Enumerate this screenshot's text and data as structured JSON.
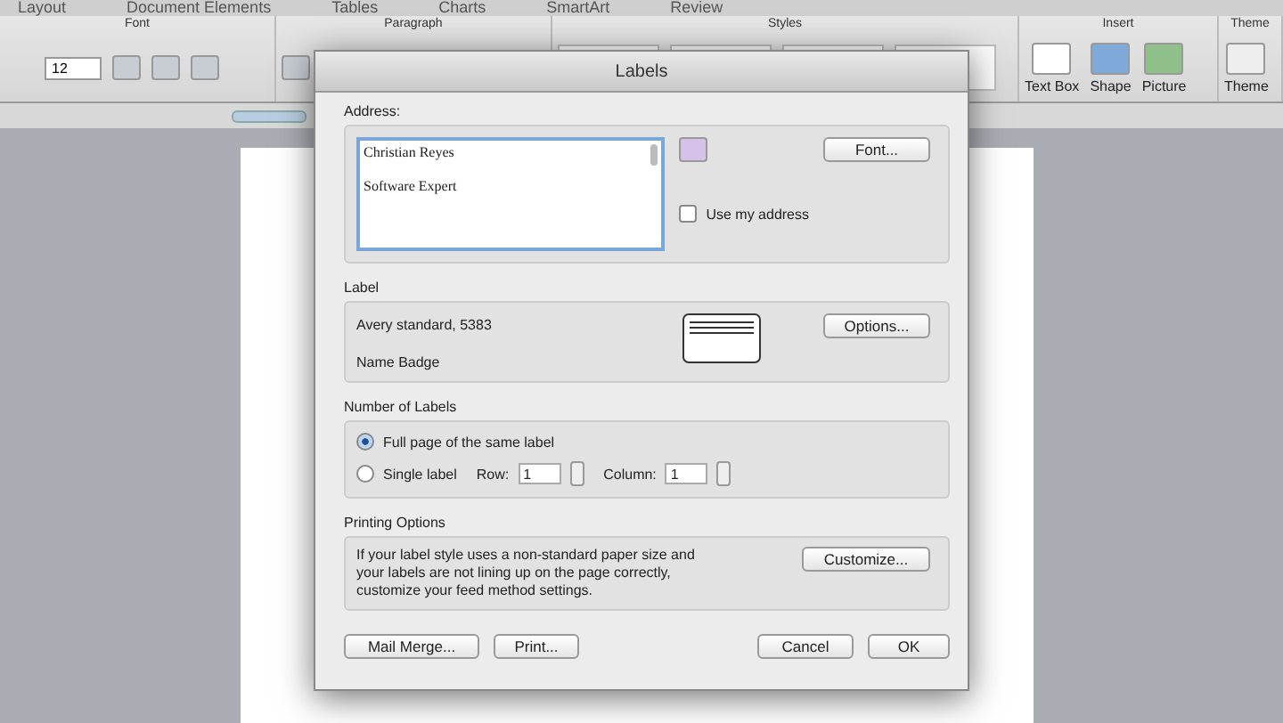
{
  "ribbon": {
    "tabs": [
      "Layout",
      "Document Elements",
      "Tables",
      "Charts",
      "SmartArt",
      "Review"
    ],
    "groups": [
      "Font",
      "Paragraph",
      "Styles",
      "Insert",
      "Theme"
    ],
    "font_size": "12",
    "insert_buttons": [
      "Text Box",
      "Shape",
      "Picture"
    ],
    "theme_button": "Theme"
  },
  "dialog": {
    "title": "Labels",
    "address": {
      "heading": "Address:",
      "lines": [
        "Christian Reyes",
        "Software Expert"
      ],
      "use_my_address": {
        "label": "Use my address",
        "checked": false
      },
      "font_button": "Font..."
    },
    "label": {
      "heading": "Label",
      "product": "Avery standard, 5383",
      "name": "Name Badge",
      "options_button": "Options..."
    },
    "number_of_labels": {
      "heading": "Number of Labels",
      "options": [
        {
          "label": "Full page of the same label",
          "selected": true
        },
        {
          "label": "Single label",
          "selected": false
        }
      ],
      "row": {
        "label": "Row:",
        "value": "1"
      },
      "column": {
        "label": "Column:",
        "value": "1"
      }
    },
    "printing_options": {
      "heading": "Printing Options",
      "text": "If your label style uses a non-standard paper size and your labels are not lining up on the page correctly, customize your feed method settings.",
      "customize_button": "Customize..."
    },
    "buttons_left": [
      "Mail Merge...",
      "Print..."
    ],
    "buttons_right": [
      "Cancel",
      "OK"
    ]
  }
}
